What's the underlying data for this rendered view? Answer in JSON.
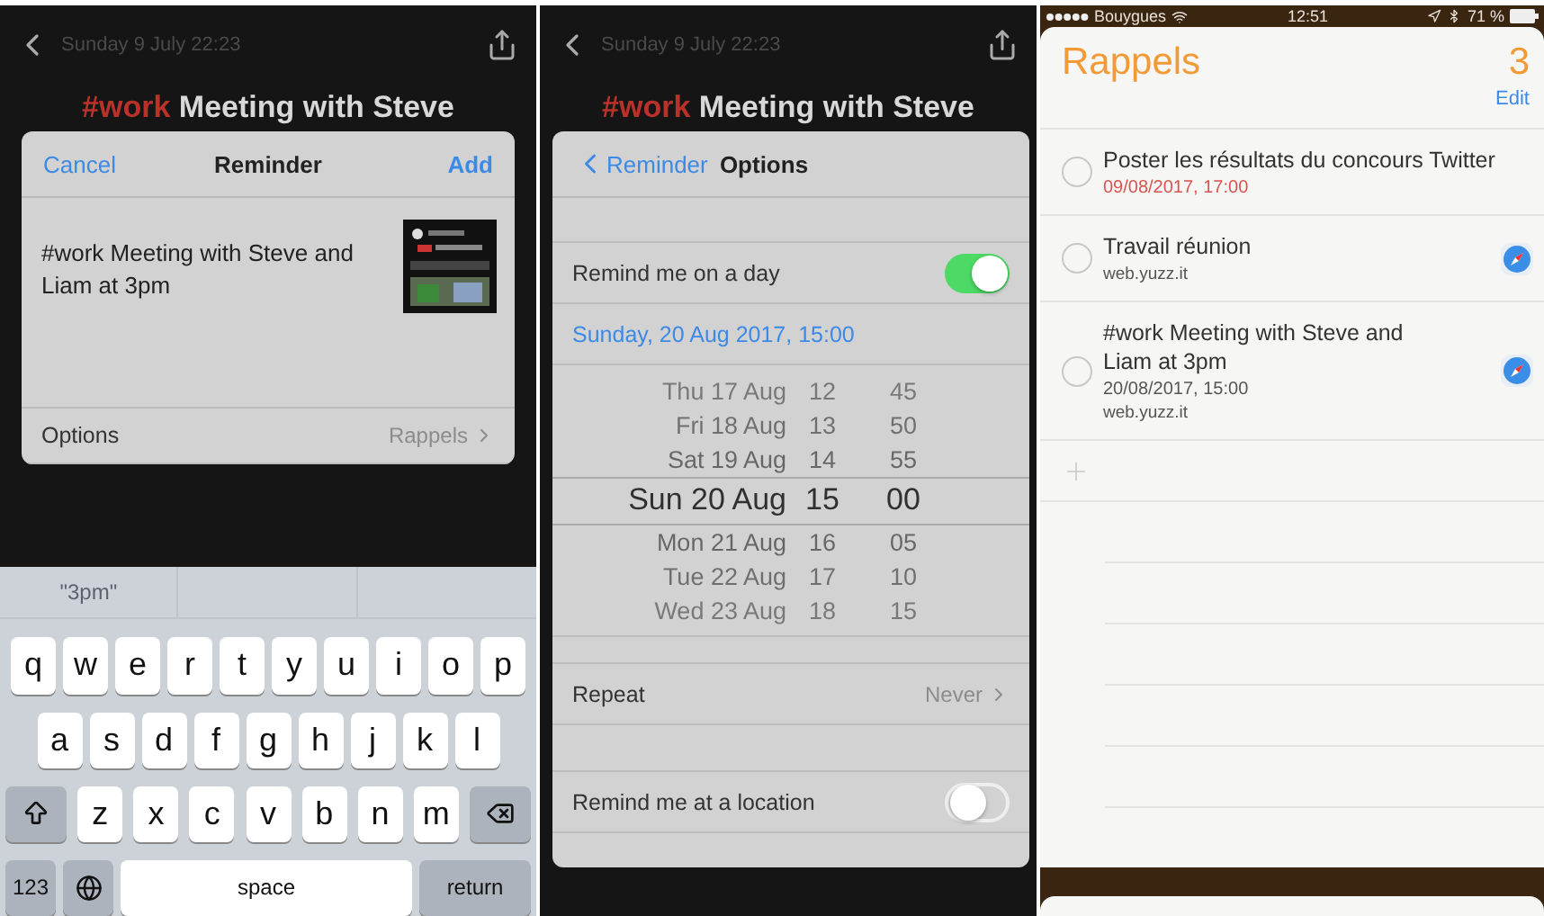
{
  "reminder_screen": {
    "header_date": "Sunday 9 July 22:23",
    "note_tag": "#work",
    "note_title": "Meeting with Steve",
    "sheet": {
      "cancel": "Cancel",
      "title": "Reminder",
      "add": "Add",
      "text": "#work Meeting with Steve and Liam at 3pm",
      "options_label": "Options",
      "options_value": "Rappels"
    },
    "keyboard": {
      "suggestion": "\"3pm\"",
      "rows": [
        {
          "keys": [
            {
              "kind": "letter",
              "label": "q"
            },
            {
              "kind": "letter",
              "label": "w"
            },
            {
              "kind": "letter",
              "label": "e"
            },
            {
              "kind": "letter",
              "label": "r"
            },
            {
              "kind": "letter",
              "label": "t"
            },
            {
              "kind": "letter",
              "label": "y"
            },
            {
              "kind": "letter",
              "label": "u"
            },
            {
              "kind": "letter",
              "label": "i"
            },
            {
              "kind": "letter",
              "label": "o"
            },
            {
              "kind": "letter",
              "label": "p"
            }
          ]
        },
        {
          "keys": [
            {
              "kind": "letter",
              "label": "a"
            },
            {
              "kind": "letter",
              "label": "s"
            },
            {
              "kind": "letter",
              "label": "d"
            },
            {
              "kind": "letter",
              "label": "f"
            },
            {
              "kind": "letter",
              "label": "g"
            },
            {
              "kind": "letter",
              "label": "h"
            },
            {
              "kind": "letter",
              "label": "j"
            },
            {
              "kind": "letter",
              "label": "k"
            },
            {
              "kind": "letter",
              "label": "l"
            }
          ]
        },
        {
          "keys": [
            {
              "kind": "shift"
            },
            {
              "kind": "letter",
              "label": "z"
            },
            {
              "kind": "letter",
              "label": "x"
            },
            {
              "kind": "letter",
              "label": "c"
            },
            {
              "kind": "letter",
              "label": "v"
            },
            {
              "kind": "letter",
              "label": "b"
            },
            {
              "kind": "letter",
              "label": "n"
            },
            {
              "kind": "letter",
              "label": "m"
            },
            {
              "kind": "delete"
            }
          ]
        },
        {
          "keys": [
            {
              "kind": "mode",
              "label": "123"
            },
            {
              "kind": "globe"
            },
            {
              "kind": "space",
              "label": "space"
            },
            {
              "kind": "return",
              "label": "return"
            }
          ]
        }
      ]
    }
  },
  "options_screen": {
    "header_date": "Sunday 9 July 22:23",
    "note_tag": "#work",
    "note_title": "Meeting with Steve",
    "back": "Reminder",
    "title": "Options",
    "remind_day": {
      "label": "Remind me on a day",
      "on": true
    },
    "date_value": "Sunday, 20 Aug 2017, 15:00",
    "picker": [
      {
        "day": "Thu 17 Aug",
        "hour": "12",
        "minute": "45",
        "selected": false
      },
      {
        "day": "Fri 18 Aug",
        "hour": "13",
        "minute": "50",
        "selected": false
      },
      {
        "day": "Sat 19 Aug",
        "hour": "14",
        "minute": "55",
        "selected": false
      },
      {
        "day": "Sun 20 Aug",
        "hour": "15",
        "minute": "00",
        "selected": true
      },
      {
        "day": "Mon 21 Aug",
        "hour": "16",
        "minute": "05",
        "selected": false
      },
      {
        "day": "Tue 22 Aug",
        "hour": "17",
        "minute": "10",
        "selected": false
      },
      {
        "day": "Wed 23 Aug",
        "hour": "18",
        "minute": "15",
        "selected": false
      }
    ],
    "repeat": {
      "label": "Repeat",
      "value": "Never"
    },
    "remind_location": {
      "label": "Remind me at a location",
      "on": false
    }
  },
  "list_screen": {
    "status": {
      "carrier": "Bouygues",
      "time": "12:51",
      "battery": "71 %"
    },
    "title": "Rappels",
    "count": "3",
    "edit": "Edit",
    "items": [
      {
        "title": "Poster les résultats du concours Twitter",
        "date": "09/08/2017, 17:00",
        "overdue": true,
        "link_icon": false,
        "completed": false
      },
      {
        "title": "Travail réunion",
        "url": "web.yuzz.it",
        "link_icon": true,
        "completed": false
      },
      {
        "title": "#work Meeting with Steve and Liam at 3pm",
        "date": "20/08/2017, 15:00",
        "overdue": false,
        "url": "web.yuzz.it",
        "link_icon": true,
        "completed": false
      }
    ]
  }
}
